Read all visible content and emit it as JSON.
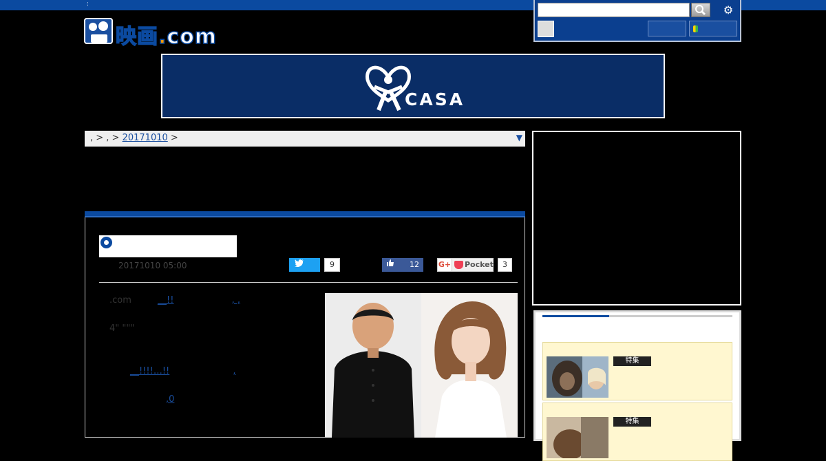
{
  "topbar": {
    "text": ":"
  },
  "logo": {
    "main": "映画",
    "dot": ".",
    "suffix": "com"
  },
  "banner": {
    "brand": "CASA"
  },
  "breadcrumb": {
    "sep1": ", > , >",
    "date_link": "20171010",
    "sep2": ">",
    "arrow": "▼"
  },
  "article": {
    "date": "20171010 05:00",
    "share": {
      "twitter_count": "9",
      "facebook_count": "12",
      "gplus": "G+",
      "pocket_label": "Pocket",
      "pocket_count": "3"
    },
    "paragraphs": [
      {
        "pre": ".com",
        "link": "__!!",
        "post": ", ,"
      },
      {
        "pre": "4\" \"\"\"",
        "link": "",
        "post": ""
      },
      {
        "pre": "",
        "link": "__!!!!…!!",
        "post": ","
      },
      {
        "pre": "",
        "link": ",0",
        "post": ""
      }
    ]
  },
  "sidebar": {
    "features": [
      {
        "tag": "特集"
      },
      {
        "tag": "特集"
      }
    ]
  },
  "colors": {
    "brand_blue": "#0b4aa0",
    "banner_navy": "#0a2d66",
    "twitter": "#1da1f2",
    "facebook": "#3b5998",
    "pocket": "#ef4056"
  }
}
